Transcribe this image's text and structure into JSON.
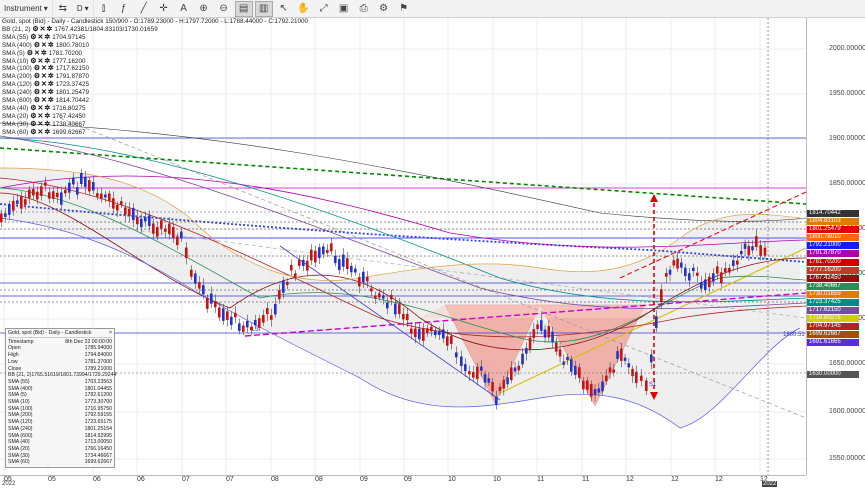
{
  "toolbar": {
    "instrument_label": "Instrument",
    "period_label": "D",
    "colors": [
      "#e8e8e8",
      "#ffffff",
      "#c8c8c8",
      "#ffffff",
      "#d8d8d8",
      "#ffffff"
    ]
  },
  "header": {
    "title": "Gold, spot (Bid) - Daily - Candlestick",
    "range": "150/900",
    "ohlc": "- O:1789.23000 - H:1797.72000 - L:1788.44000 - C:1792.21000"
  },
  "legend": [
    {
      "name": "BB (21, 2)",
      "value": "1767.42381/1804.83103/1730.01659"
    },
    {
      "name": "SMA (55)",
      "value": "1704.97145"
    },
    {
      "name": "SMA (400)",
      "value": "1800.78010"
    },
    {
      "name": "SMA (5)",
      "value": "1781.70200"
    },
    {
      "name": "SMA (10)",
      "value": "1777.16200"
    },
    {
      "name": "SMA (100)",
      "value": "1717.62150"
    },
    {
      "name": "SMA (200)",
      "value": "1791.87870"
    },
    {
      "name": "SMA (120)",
      "value": "1723.37425"
    },
    {
      "name": "SMA (240)",
      "value": "1801.25479"
    },
    {
      "name": "SMA (600)",
      "value": "1814.70442"
    },
    {
      "name": "SMA (40)",
      "value": "1716.80275"
    },
    {
      "name": "SMA (20)",
      "value": "1767.42450"
    },
    {
      "name": "SMA (30)",
      "value": "1738.40667"
    },
    {
      "name": "SMA (60)",
      "value": "1699.62667"
    }
  ],
  "chart": {
    "pattern_labels": [
      "L3",
      "S1"
    ],
    "extra_labels": [
      "1880.51"
    ],
    "y_ticks": [
      "2000.00000",
      "1950.00000",
      "1900.00000",
      "1850.00000",
      "1800.00000",
      "1750.00000",
      "1700.00000",
      "1650.00000",
      "1600.00000",
      "1550.00000"
    ],
    "price_tags": [
      {
        "text": "1814.70442",
        "color": "#333333"
      },
      {
        "text": "1804.83103",
        "color": "#e07b00"
      },
      {
        "text": "1801.25479",
        "color": "#e00000"
      },
      {
        "text": "1800.78010",
        "color": "#ff6a00"
      },
      {
        "text": "1792.21000",
        "color": "#1a1aff"
      },
      {
        "text": "1791.87870",
        "color": "#b000b0"
      },
      {
        "text": "1781.70200",
        "color": "#d00000"
      },
      {
        "text": "1777.16200",
        "color": "#c0392b"
      },
      {
        "text": "1767.42450",
        "color": "#8b1010"
      },
      {
        "text": "1738.40667",
        "color": "#2e8b57"
      },
      {
        "text": "1730.01659",
        "color": "#e07b00"
      },
      {
        "text": "1723.37425",
        "color": "#008b8b"
      },
      {
        "text": "1717.62150",
        "color": "#7a4d9b"
      },
      {
        "text": "1716.80275",
        "color": "#cfcf00"
      },
      {
        "text": "1704.97145",
        "color": "#b22222"
      },
      {
        "text": "1699.62667",
        "color": "#a05000"
      },
      {
        "text": "1691.61665",
        "color": "#5a2ddb"
      },
      {
        "text": "1630.00000",
        "color": "#555555"
      }
    ],
    "x_labels": [
      "05",
      "05",
      "06",
      "06",
      "07",
      "07",
      "08",
      "08",
      "09",
      "09",
      "10",
      "10",
      "11",
      "11",
      "12",
      "12",
      "12",
      "12"
    ],
    "x_year_left": "2022",
    "x_year_right": "2022"
  },
  "infobox": {
    "title": "Gold, spot (Bid) - Daily - Candlestick",
    "rows": [
      [
        "Timestamp",
        "8th Dec 22 00:00:00"
      ],
      [
        "Open",
        "1785.94000"
      ],
      [
        "High",
        "1794.84000"
      ],
      [
        "Low",
        "1781.37000"
      ],
      [
        "Close",
        "1789.21000"
      ],
      [
        "BB (21, 2)",
        "1765.51619/1801.73994/1729.29244"
      ],
      [
        "SMA (55)",
        "1703.23563"
      ],
      [
        "SMA (400)",
        "1801.04455"
      ],
      [
        "SMA (5)",
        "1782.61200"
      ],
      [
        "SMA (10)",
        "1773.30700"
      ],
      [
        "SMA (100)",
        "1716.95750"
      ],
      [
        "SMA (200)",
        "1792.59155"
      ],
      [
        "SMA (120)",
        "1723.65175"
      ],
      [
        "SMA (240)",
        "1801.25154"
      ],
      [
        "SMA (600)",
        "1814.92995"
      ],
      [
        "SMA (40)",
        "1713.00050"
      ],
      [
        "SMA (20)",
        "1766.16450"
      ],
      [
        "SMA (30)",
        "1734.46667"
      ],
      [
        "SMA (60)",
        "1699.62667"
      ]
    ]
  }
}
